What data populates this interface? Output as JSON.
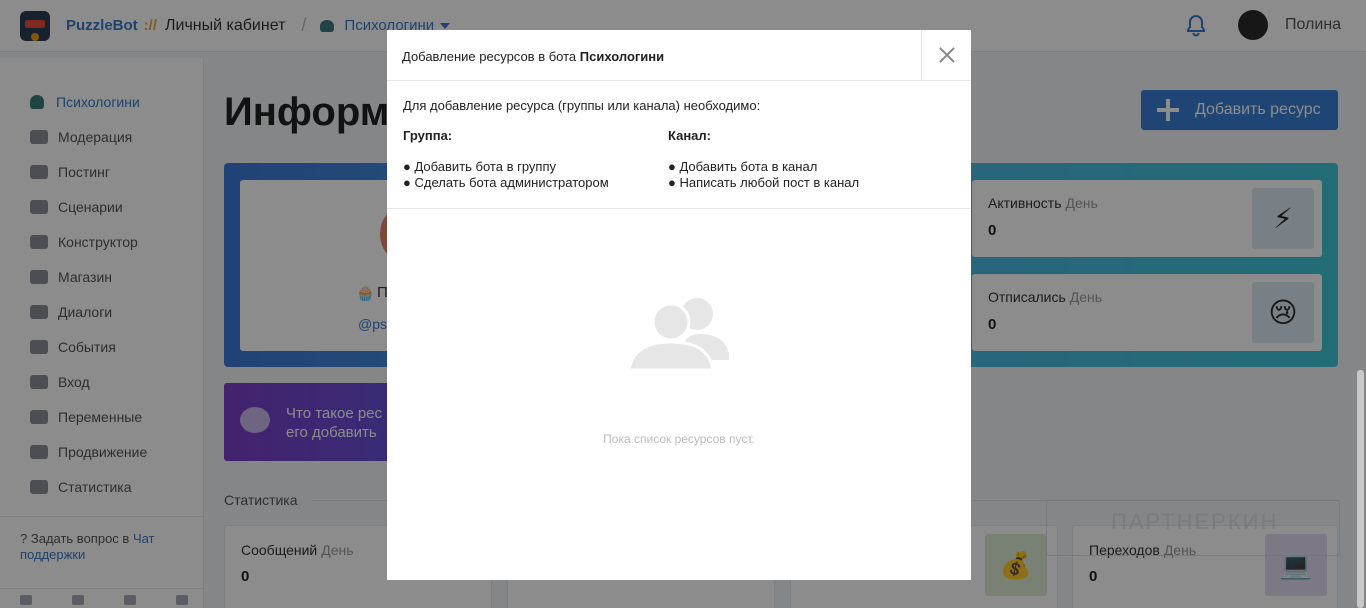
{
  "header": {
    "brand": "PuzzleBot",
    "brand_sep": "://",
    "crumb": "Личный кабинет",
    "crumb_slash": "/",
    "bot_name": "Психологини",
    "user_name": "Полина"
  },
  "sidebar": {
    "items": [
      {
        "label": "Психологини",
        "icon": "cupcake-icon",
        "active": true
      },
      {
        "label": "Модерация",
        "icon": "users-icon"
      },
      {
        "label": "Постинг",
        "icon": "paper-plane-icon"
      },
      {
        "label": "Сценарии",
        "icon": "scenario-icon"
      },
      {
        "label": "Конструктор",
        "icon": "grid-icon"
      },
      {
        "label": "Магазин",
        "icon": "cart-icon"
      },
      {
        "label": "Диалоги",
        "icon": "comment-icon"
      },
      {
        "label": "События",
        "icon": "star-icon"
      },
      {
        "label": "Вход",
        "icon": "sign-in-icon"
      },
      {
        "label": "Переменные",
        "icon": "variable-icon"
      },
      {
        "label": "Продвижение",
        "icon": "rocket-icon"
      },
      {
        "label": "Статистика",
        "icon": "pie-chart-icon"
      }
    ],
    "support_text": "Задать вопрос в ",
    "support_link": "Чат поддержки"
  },
  "main": {
    "title": "Информа",
    "add_button": "Добавить ресурс",
    "profile_partial": "П",
    "handle_partial": "@psy",
    "banner_text_1": "Что такое рес",
    "banner_text_2": "его добавить",
    "stats_heading": "Статистика",
    "cards": {
      "activity": {
        "label": "Активность",
        "period": "День",
        "value": "0",
        "icon": "⚡"
      },
      "unsub": {
        "label": "Отписались",
        "period": "День",
        "value": "0",
        "icon": "😢"
      },
      "messages": {
        "label": "Сообщений",
        "period": "День",
        "value": "0"
      },
      "money": {
        "icon": "💰"
      },
      "transitions": {
        "label": "Переходов",
        "period": "День",
        "value": "0",
        "icon": "💻"
      }
    },
    "watermark": "ПАРТНЕРКИН"
  },
  "modal": {
    "title_prefix": "Добавление ресурсов в бота ",
    "title_bot": "Психологини",
    "intro": "Для добавление ресурса (группы или канала) необходимо:",
    "group": {
      "heading": "Группа:",
      "steps": [
        "● Добавить бота в группу",
        "● Сделать бота администратором"
      ]
    },
    "channel": {
      "heading": "Канал:",
      "steps": [
        "● Добавить бота в канал",
        "● Написать любой пост в канал"
      ]
    },
    "empty_text": "Пока список ресурсов пуст."
  },
  "colors": {
    "accent": "#3a78c9",
    "button": "#3a7fd5",
    "overlay": "rgba(0,0,0,0.45)"
  }
}
